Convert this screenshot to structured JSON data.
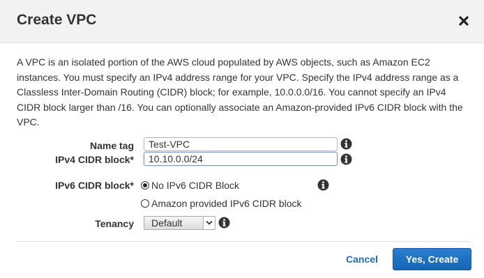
{
  "dialog": {
    "title": "Create VPC",
    "close_icon": "close-icon"
  },
  "description": "A VPC is an isolated portion of the AWS cloud populated by AWS objects, such as Amazon EC2 instances. You must specify an IPv4 address range for your VPC. Specify the IPv4 address range as a Classless Inter-Domain Routing (CIDR) block; for example, 10.0.0.0/16. You cannot specify an IPv4 CIDR block larger than /16. You can optionally associate an Amazon-provided IPv6 CIDR block with the VPC.",
  "form": {
    "name_tag": {
      "label": "Name tag",
      "value": "Test-VPC",
      "info_icon": "info-icon"
    },
    "ipv4_cidr": {
      "label": "IPv4 CIDR block*",
      "value": "10.10.0.0/24",
      "info_icon": "info-icon"
    },
    "ipv6_cidr": {
      "label": "IPv6 CIDR block*",
      "info_icon": "info-icon",
      "options": [
        {
          "label": "No IPv6 CIDR Block",
          "checked": true
        },
        {
          "label": "Amazon provided IPv6 CIDR block",
          "checked": false
        }
      ]
    },
    "tenancy": {
      "label": "Tenancy",
      "value": "Default",
      "info_icon": "info-icon"
    }
  },
  "footer": {
    "cancel_label": "Cancel",
    "create_label": "Yes, Create"
  },
  "colors": {
    "header_bg": "#f2f2f2",
    "link": "#1a6eb3",
    "primary_button": "#1a6fc4"
  }
}
